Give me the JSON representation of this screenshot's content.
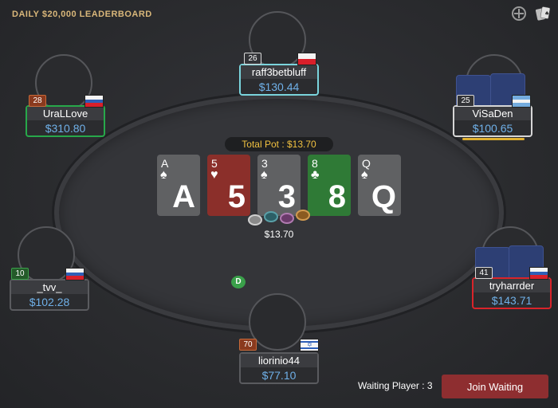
{
  "header": {
    "leaderboard": "DAILY $20,000 LEADERBOARD"
  },
  "icons": [
    "target-icon",
    "cards-icon"
  ],
  "pot": {
    "label": "Total Pot : $13.70",
    "chips_amount": "$13.70"
  },
  "board": [
    {
      "rank": "A",
      "suit": "♠",
      "suit_name": "spade"
    },
    {
      "rank": "5",
      "suit": "♥",
      "suit_name": "heart"
    },
    {
      "rank": "3",
      "suit": "♠",
      "suit_name": "spade"
    },
    {
      "rank": "8",
      "suit": "♣",
      "suit_name": "club"
    },
    {
      "rank": "Q",
      "suit": "♠",
      "suit_name": "spade"
    }
  ],
  "dealer": "D",
  "players": {
    "top": {
      "name": "raff3betbluff",
      "stack": "$130.44",
      "level": "26",
      "flag": "poland"
    },
    "left_upper": {
      "name": "UraLLove",
      "stack": "$310.80",
      "level": "28",
      "flag": "russia"
    },
    "right_upper": {
      "name": "ViSaDen",
      "stack": "$100.65",
      "level": "25",
      "flag": "argentina"
    },
    "left_lower": {
      "name": "_tvv_",
      "stack": "$102.28",
      "level": "10",
      "flag": "russia"
    },
    "right_lower": {
      "name": "tryharrder",
      "stack": "$143.71",
      "level": "41",
      "flag": "russia"
    },
    "bottom": {
      "name": "liorinio44",
      "stack": "$77.10",
      "level": "70",
      "flag": "israel"
    }
  },
  "waiting": {
    "label": "Waiting Player : 3",
    "button": "Join Waiting"
  },
  "colors": {
    "accent_gold": "#d9b77a",
    "pot_text": "#f0c040",
    "stack_text": "#6fb0e8",
    "join_button": "#8e2e30"
  }
}
